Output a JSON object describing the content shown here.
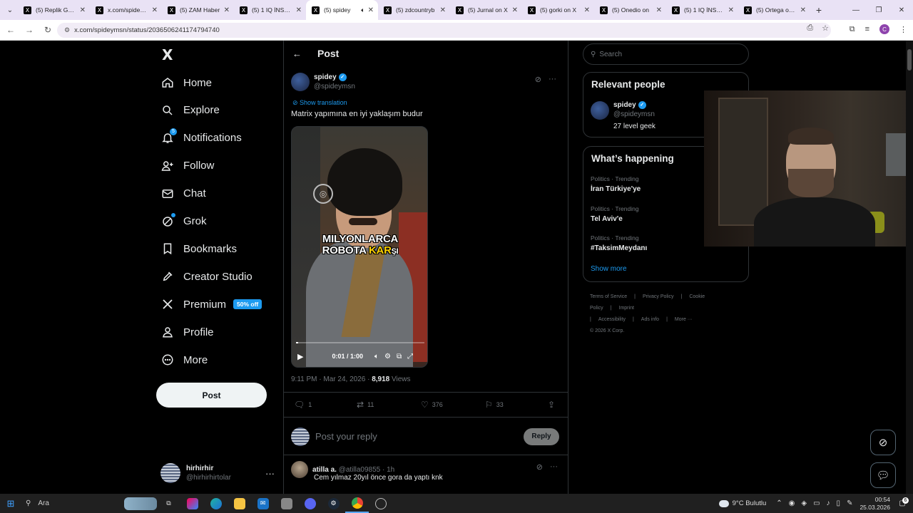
{
  "browser": {
    "tabs": [
      {
        "title": "(5) Replik Gelsi",
        "active": false
      },
      {
        "title": "x.com/spideymsn",
        "active": false
      },
      {
        "title": "(5) ZAM Haber",
        "active": false
      },
      {
        "title": "(5) 1 IQ İNSANI",
        "active": false
      },
      {
        "title": "(5) spidey",
        "active": true
      },
      {
        "title": "(5) zdcountryb",
        "active": false
      },
      {
        "title": "(5) Jurnal on X",
        "active": false
      },
      {
        "title": "(5) gorki on X",
        "active": false
      },
      {
        "title": "(5) Onedio on",
        "active": false
      },
      {
        "title": "(5) 1 IQ İNSANI",
        "active": false
      },
      {
        "title": "(5) Ortega on X",
        "active": false
      }
    ],
    "new_tab_label": "+",
    "url": "x.com/spideymsn/status/2036506241174794740",
    "profile_initial": "C"
  },
  "nav": {
    "logo": "X",
    "items": [
      {
        "label": "Home",
        "icon": "home-icon"
      },
      {
        "label": "Explore",
        "icon": "search-icon"
      },
      {
        "label": "Notifications",
        "icon": "bell-icon",
        "badge": "5"
      },
      {
        "label": "Follow",
        "icon": "add-person-icon"
      },
      {
        "label": "Chat",
        "icon": "mail-icon"
      },
      {
        "label": "Grok",
        "icon": "grok-icon"
      },
      {
        "label": "Bookmarks",
        "icon": "bookmark-icon"
      },
      {
        "label": "Creator Studio",
        "icon": "rocket-icon"
      },
      {
        "label": "Premium",
        "icon": "x-icon",
        "promo": "50% off"
      },
      {
        "label": "Profile",
        "icon": "person-icon"
      },
      {
        "label": "More",
        "icon": "more-circle-icon"
      }
    ],
    "post_button": "Post",
    "account": {
      "name": "hirhirhir",
      "handle": "@hirhirhirtolar"
    }
  },
  "post": {
    "header_title": "Post",
    "author_name": "spidey",
    "author_handle": "@spideymsn",
    "show_translation": "Show translation",
    "text": "Matrix yapımına en iyi yaklaşım budur",
    "video": {
      "caption_line1": "MILYONLARCA",
      "caption_line2_a": "ROBOTA ",
      "caption_line2_b": "KAR",
      "caption_line2_c": "ŞI",
      "time": "0:01 / 1:00",
      "progress": 0.017
    },
    "timestamp": "9:11 PM · Mar 24, 2026 · ",
    "views_count": "8,918",
    "views_label": " Views",
    "stats": {
      "replies": "1",
      "reposts": "11",
      "likes": "376",
      "bookmarks": "33"
    },
    "reply_placeholder": "Post your reply",
    "reply_button": "Reply"
  },
  "comment": {
    "name": "atilla a.",
    "handle": "@atilla09855",
    "age": " · 1h",
    "text": "Cem yılmaz 20yıl önce gora da yaptı knk"
  },
  "sidebar": {
    "search_placeholder": "Search",
    "relevant_title": "Relevant people",
    "relevant": {
      "name": "spidey",
      "handle": "@spideymsn",
      "bio": "27 level geek"
    },
    "happening_title": "What’s happening",
    "trends": [
      {
        "category": "Politics · Trending",
        "name": "İran Türkiye'ye"
      },
      {
        "category": "Politics · Trending",
        "name": "Tel Aviv'e"
      },
      {
        "category": "Politics · Trending",
        "name": "#TaksimMeydanı"
      }
    ],
    "show_more": "Show more",
    "footer": [
      "Terms of Service",
      "|",
      "Privacy Policy",
      "|",
      "Cookie Policy",
      "|",
      "Imprint",
      "|",
      "Accessibility",
      "|",
      "Ads info",
      "|",
      "More ···",
      "© 2026 X Corp."
    ]
  },
  "taskbar": {
    "search_label": "Ara",
    "weather": "9°C  Bulutlu",
    "time": "00:54",
    "date": "25.03.2026",
    "notif_count": "6"
  },
  "colors": {
    "accent": "#1d9bf0",
    "background": "#000000",
    "border": "#2f3336",
    "muted": "#71767b"
  }
}
